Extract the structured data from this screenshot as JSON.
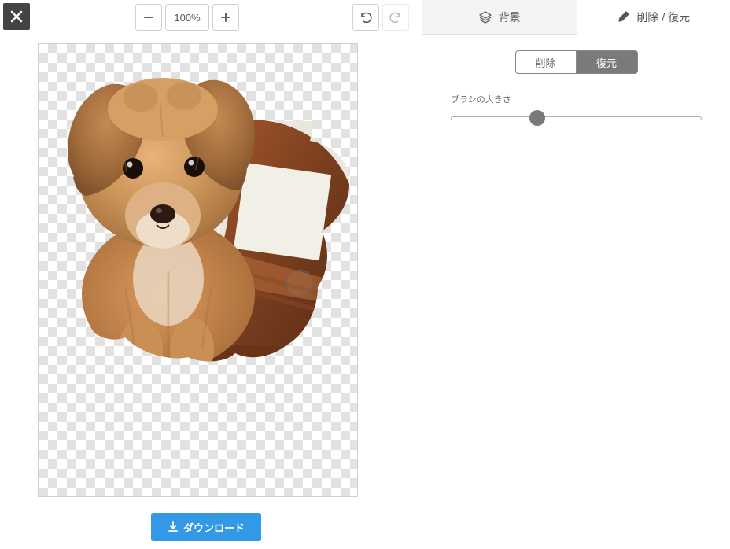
{
  "toolbar": {
    "zoom_level": "100%",
    "download_label": "ダウンロード"
  },
  "tabs": {
    "background_label": "背景",
    "erase_restore_label": "削除 / 復元"
  },
  "panel": {
    "mode_erase": "削除",
    "mode_restore": "復元",
    "brush_size_label": "ブラシの大きさ",
    "brush_size_value": 36
  },
  "colors": {
    "primary_blue": "#3399e6",
    "dark_gray": "#7a7a7a"
  }
}
